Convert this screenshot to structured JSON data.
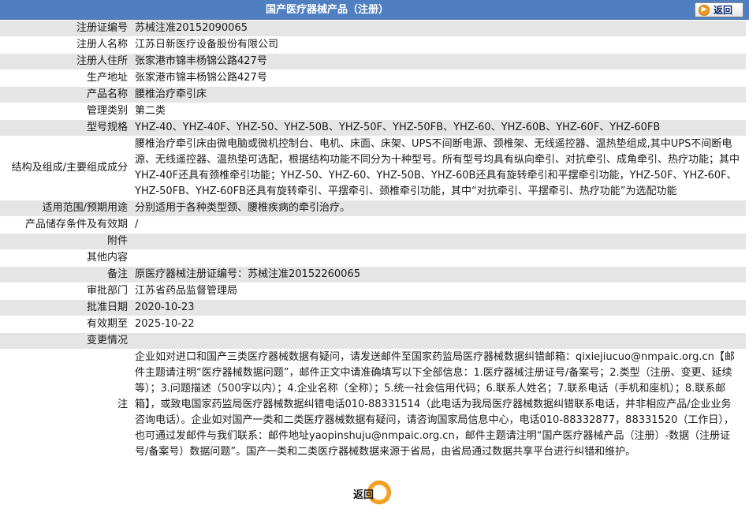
{
  "header": {
    "title": "国产医疗器械产品（注册）",
    "back_label": "返回"
  },
  "rows": [
    {
      "label": "注册证编号",
      "value": "苏械注准20152090065"
    },
    {
      "label": "注册人名称",
      "value": "江苏日新医疗设备股份有限公司"
    },
    {
      "label": "注册人住所",
      "value": "张家港市锦丰杨锦公路427号"
    },
    {
      "label": "生产地址",
      "value": "张家港市锦丰杨锦公路427号"
    },
    {
      "label": "产品名称",
      "value": "腰椎治疗牵引床"
    },
    {
      "label": "管理类别",
      "value": "第二类"
    },
    {
      "label": "型号规格",
      "value": "YHZ-40、YHZ-40F、YHZ-50、YHZ-50B、YHZ-50F、YHZ-50FB、YHZ-60、YHZ-60B、YHZ-60F、YHZ-60FB"
    },
    {
      "label": "结构及组成/主要组成成分",
      "value": "腰椎治疗牵引床由微电脑或微机控制台、电机、床面、床架、UPS不间断电源、颈椎架、无线遥控器、温热垫组成,其中UPS不间断电源、无线遥控器、温热垫可选配，根据结构功能不同分为十种型号。所有型号均具有纵向牵引、对抗牵引、成角牵引、热疗功能；其中YHZ-40F还具有颈椎牵引功能；YHZ-50、YHZ-60、YHZ-50B、YHZ-60B还具有旋转牵引和平摆牵引功能，YHZ-50F、YHZ-60F、YHZ-50FB、YHZ-60FB还具有旋转牵引、平摆牵引、颈椎牵引功能，其中“对抗牵引、平摆牵引、热疗功能”为选配功能"
    },
    {
      "label": "适用范围/预期用途",
      "value": "分别适用于各种类型颈、腰椎疾病的牵引治疗。"
    },
    {
      "label": "产品储存条件及有效期",
      "value": "/"
    },
    {
      "label": "附件",
      "value": ""
    },
    {
      "label": "其他内容",
      "value": ""
    },
    {
      "label": "备注",
      "value": "原医疗器械注册证编号：苏械注准20152260065"
    },
    {
      "label": "审批部门",
      "value": "江苏省药品监督管理局"
    },
    {
      "label": "批准日期",
      "value": "2020-10-23"
    },
    {
      "label": "有效期至",
      "value": "2025-10-22"
    },
    {
      "label": "变更情况",
      "value": ""
    }
  ],
  "note": {
    "label": "注",
    "part1": "企业如对进口和国产三类医疗器械数据有疑问，请发送邮件至国家药监局医疗器械数据纠错邮箱：",
    "email1": "qixiejiucuo@nmpaic.org.cn",
    "part2": "【邮件主题请注明“医疗器械数据问题”，邮件正文中请准确填写以下全部信息：1.医疗器械注册证号/备案号；2.类型（注册、变更、延续等）；3.问题描述（500字以内）；4.企业名称（全称）；5.统一社会信用代码；6.联系人姓名；7.联系电话（手机和座机）；8.联系邮箱】，或致电国家药监局医疗器械数据纠错电话010-88331514（此电话为我局医疗器械数据纠错联系电话，并非相应产品/企业业务咨询电话）。企业如对国产一类和二类医疗器械数据有疑问，请咨询国家局信息中心，电话010-88332877，88331520（工作日），也可通过发邮件与我们联系：邮件地址",
    "email2": "yaopinshuju@nmpaic.org.cn",
    "part3": "，邮件主题请注明“国产医疗器械产品（注册）-数据（注册证号/备案号）数据问题”。国产一类和二类医疗器械数据来源于省局，由省局通过数据共享平台进行纠错和维护。"
  },
  "footer": {
    "back_label": "返回"
  }
}
